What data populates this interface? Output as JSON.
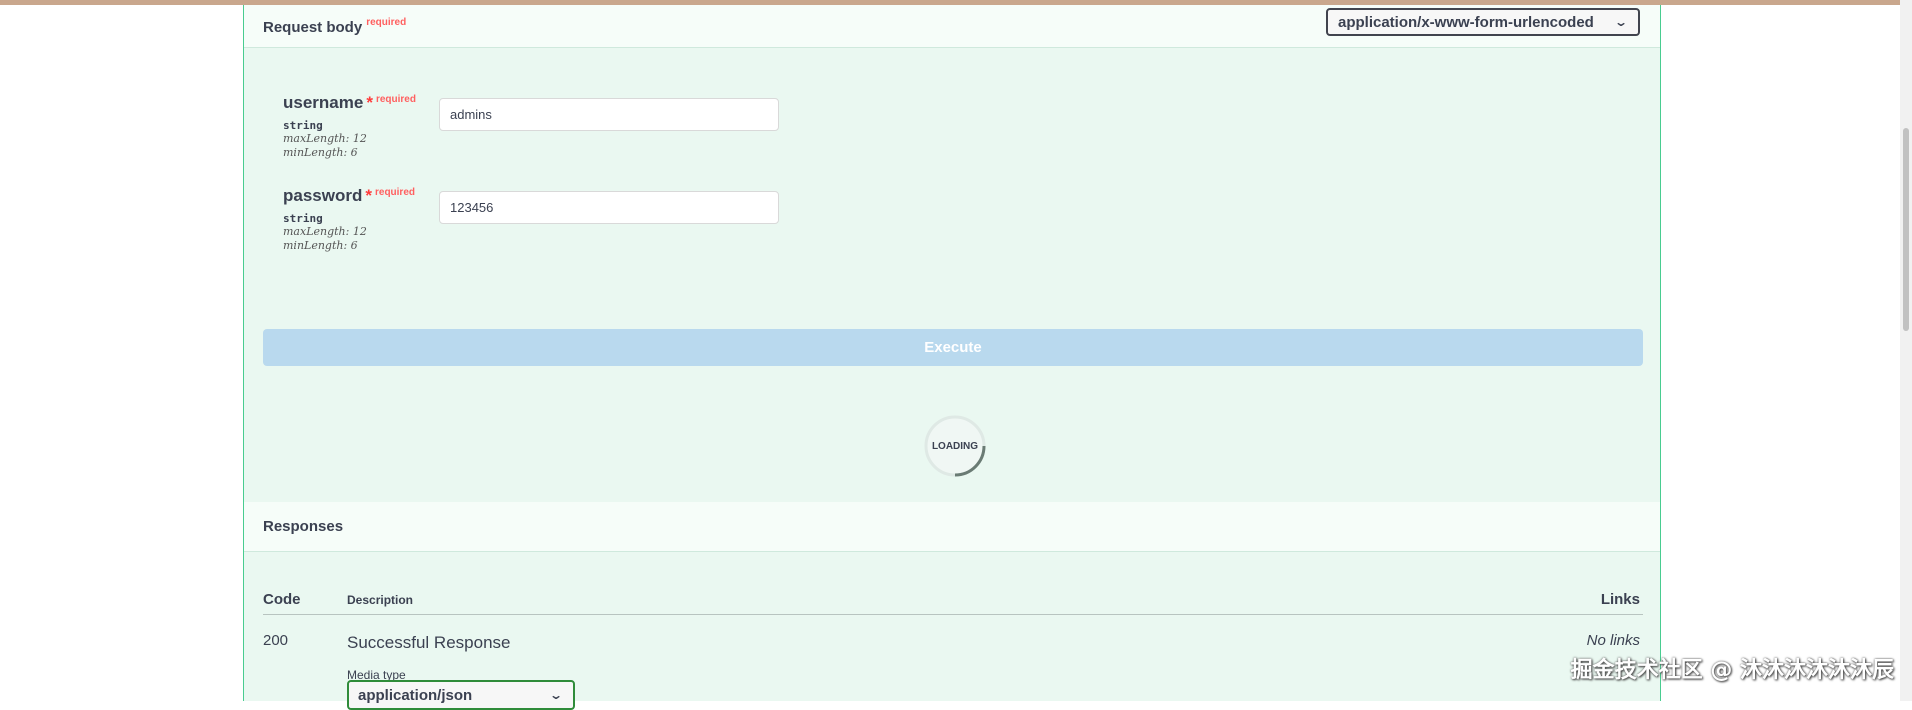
{
  "request_body": {
    "title": "Request body",
    "required_label": "required",
    "content_type": "application/x-www-form-urlencoded"
  },
  "params": [
    {
      "name": "username",
      "star": "*",
      "required": "required",
      "type": "string",
      "max_length": "maxLength: 12",
      "min_length": "minLength: 6",
      "value": "admins"
    },
    {
      "name": "password",
      "star": "*",
      "required": "required",
      "type": "string",
      "max_length": "maxLength: 12",
      "min_length": "minLength: 6",
      "value": "123456"
    }
  ],
  "execute_label": "Execute",
  "loading_label": "LOADING",
  "responses": {
    "title": "Responses",
    "col_code": "Code",
    "col_description": "Description",
    "col_links": "Links",
    "rows": [
      {
        "code": "200",
        "description": "Successful Response",
        "links": "No links",
        "media_type_label": "Media type",
        "media_type": "application/json"
      }
    ]
  },
  "watermark": "掘金技术社区 @ 沐沐沐沐沐沐辰",
  "colors": {
    "panel_bg": "#eaf8f1",
    "border_green": "#49cc90",
    "execute_bg": "#b9d9ee",
    "required_red": "#ff6060"
  }
}
